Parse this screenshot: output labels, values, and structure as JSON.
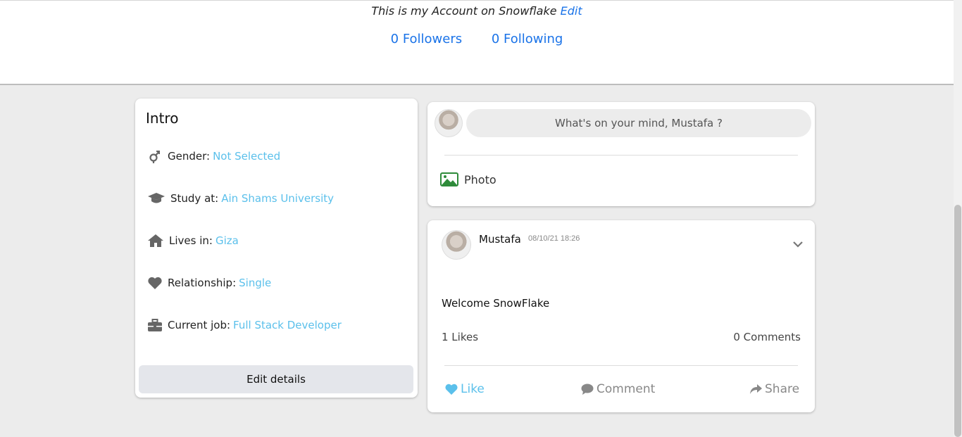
{
  "header": {
    "bio": "This is my Account on Snowflake",
    "bio_edit": "Edit",
    "followers": "0 Followers",
    "following": "0 Following"
  },
  "intro": {
    "title": "Intro",
    "rows": [
      {
        "icon": "gender-icon",
        "label": "Gender:",
        "value": "Not Selected"
      },
      {
        "icon": "graduation-cap-icon",
        "label": "Study at:",
        "value": "Ain Shams University"
      },
      {
        "icon": "home-icon",
        "label": "Lives in:",
        "value": "Giza"
      },
      {
        "icon": "heart-icon",
        "label": "Relationship:",
        "value": "Single"
      },
      {
        "icon": "briefcase-icon",
        "label": "Current job:",
        "value": "Full Stack Developer"
      }
    ],
    "edit_button": "Edit details"
  },
  "composer": {
    "placeholder": "What's on your mind, Mustafa ?",
    "photo_label": "Photo"
  },
  "post": {
    "author": "Mustafa",
    "time": "08/10/21 18:26",
    "text": "Welcome SnowFlake",
    "likes": "1 Likes",
    "comments": "0 Comments",
    "like_label": "Like",
    "comment_label": "Comment",
    "share_label": "Share"
  },
  "colors": {
    "link_blue": "#1a73e8",
    "value_blue": "#5bc0eb",
    "photo_green": "#2e8b3a"
  }
}
